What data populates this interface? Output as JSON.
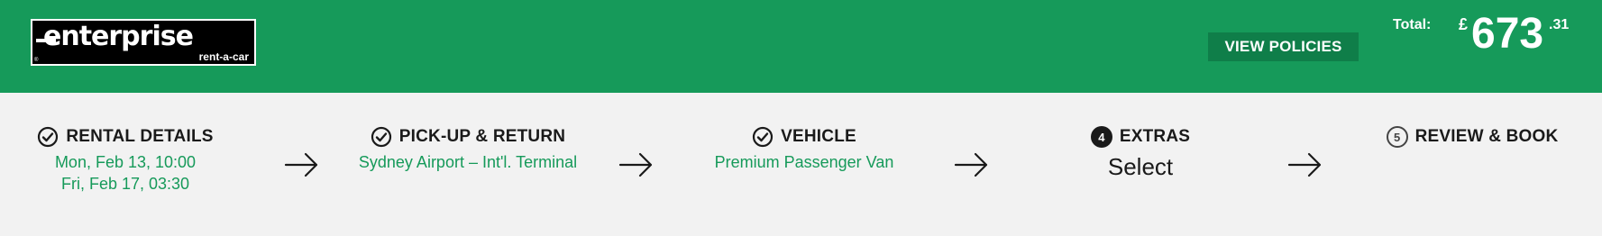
{
  "header": {
    "logo": {
      "brand": "enterprise",
      "tagline": "rent-a-car",
      "mark": "®"
    },
    "view_policies_label": "VIEW POLICIES",
    "total": {
      "label": "Total:",
      "currency": "£",
      "whole": "673",
      "cents": ".31"
    },
    "colors": {
      "brand_green": "#169a5a",
      "button_green": "#0f7e49"
    }
  },
  "steps": [
    {
      "title": "RENTAL DETAILS",
      "icon": "check-circle-icon",
      "lines": [
        "Mon, Feb 13, 10:00",
        "Fri, Feb 17, 03:30"
      ]
    },
    {
      "title": "PICK-UP & RETURN",
      "icon": "check-circle-icon",
      "lines": [
        "Sydney Airport – Int'l. Terminal"
      ]
    },
    {
      "title": "VEHICLE",
      "icon": "check-circle-icon",
      "lines": [
        "Premium Passenger Van"
      ]
    },
    {
      "number": "4",
      "title": "EXTRAS",
      "icon": "step-number-filled-icon",
      "action": "Select"
    },
    {
      "number": "5",
      "title": "REVIEW & BOOK",
      "icon": "step-number-outline-icon"
    }
  ],
  "separator_icon": "arrow-right-icon"
}
